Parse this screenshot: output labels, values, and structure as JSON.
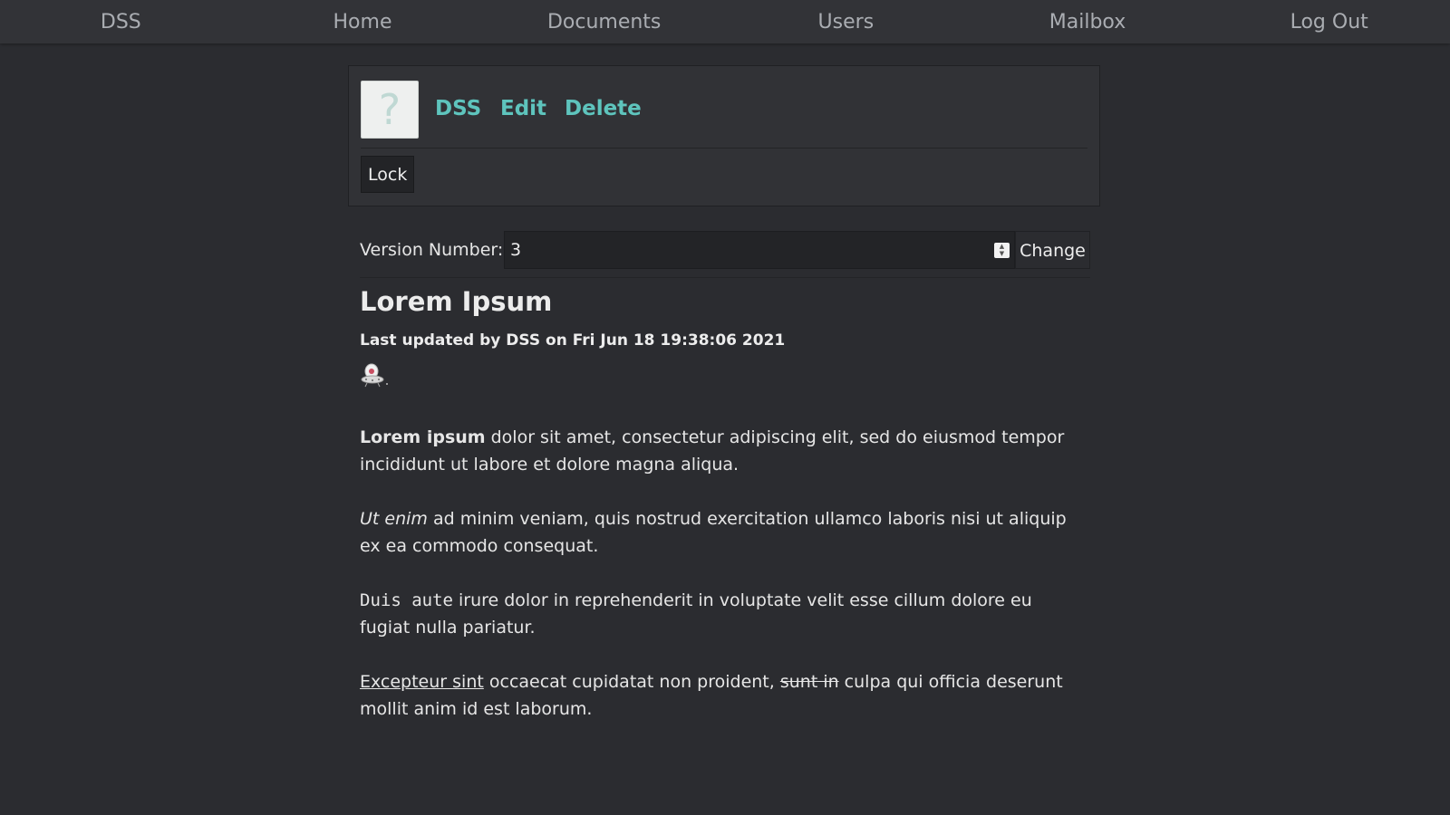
{
  "navbar": {
    "items": [
      {
        "label": "DSS"
      },
      {
        "label": "Home"
      },
      {
        "label": "Documents"
      },
      {
        "label": "Users"
      },
      {
        "label": "Mailbox"
      },
      {
        "label": "Log Out"
      }
    ]
  },
  "doc_card": {
    "icon_glyph": "?",
    "icon": "question-mark-icon",
    "owner_link": "DSS",
    "edit_link": "Edit",
    "delete_link": "Delete",
    "lock_button": "Lock"
  },
  "version": {
    "label": "Version Number:",
    "value": "3",
    "change_button": "Change"
  },
  "document": {
    "title": "Lorem Ipsum",
    "last_updated": "Last updated by DSS on Fri Jun 18 19:38:06 2021",
    "avatar_icon": "ufo-icon",
    "paragraphs": [
      {
        "bold": "Lorem ipsum",
        "rest": " dolor sit amet, consectetur adipiscing elit, sed do eiusmod tempor incididunt ut labore et dolore magna aliqua."
      },
      {
        "italic": "Ut enim",
        "rest": " ad minim veniam, quis nostrud exercitation ullamco laboris nisi ut aliquip ex ea commodo consequat."
      },
      {
        "code": "Duis aute",
        "rest": " irure dolor in reprehenderit in voluptate velit esse cillum dolore eu fugiat nulla pariatur."
      },
      {
        "underline": "Excepteur sint",
        "middle": " occaecat cupidatat non proident, ",
        "strike": "sunt in",
        "rest": " culpa qui officia deserunt mollit anim id est laborum."
      }
    ]
  },
  "colors": {
    "background": "#2b2c30",
    "navbar": "#323337",
    "link_accent": "#5ec4bd"
  }
}
